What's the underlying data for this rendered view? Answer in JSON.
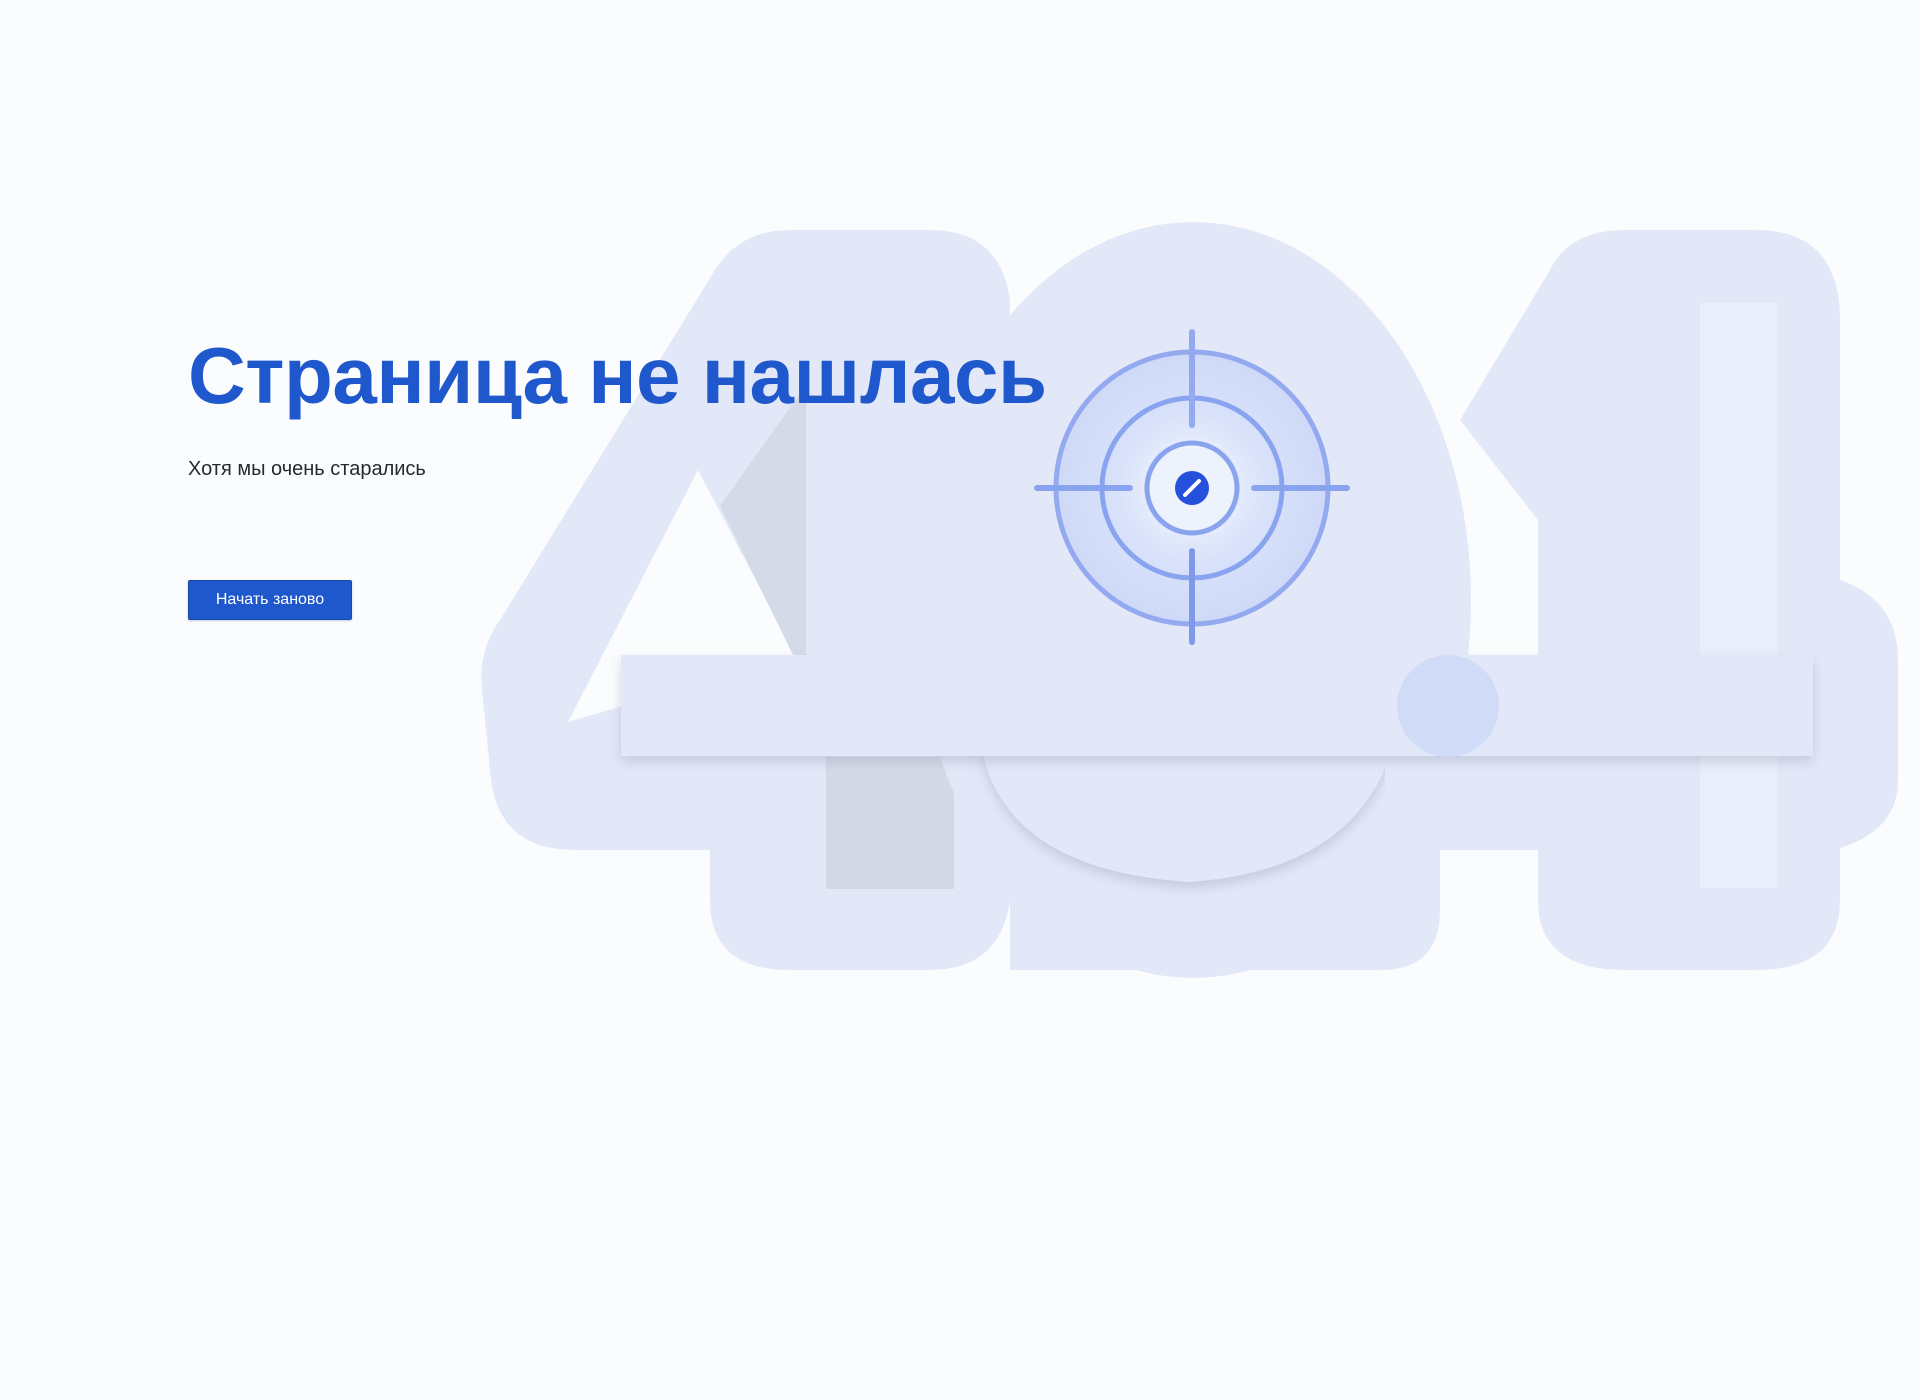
{
  "page": {
    "title": "Страница не нашлась",
    "subtitle": "Хотя мы очень старались",
    "restart_button_label": "Начать заново"
  },
  "illustration": {
    "graphic": "404",
    "icon": "target-crosshair-icon"
  },
  "colors": {
    "background": "#fbfcfd",
    "accent": "#1f58cc",
    "illustration_fill": "#e2e8f8",
    "illustration_shade": "#d2d8e6",
    "target_ring": "#8aa3ee",
    "target_center": "#2450db",
    "text": "#242a33"
  }
}
